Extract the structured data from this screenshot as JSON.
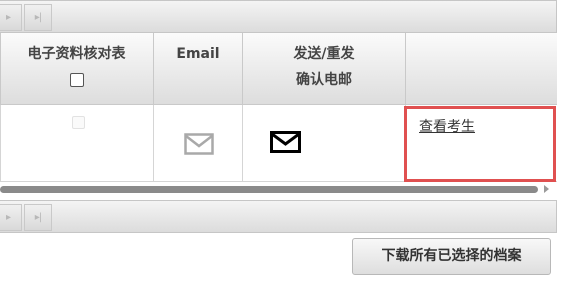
{
  "pager": {
    "next_icon": "next-page-icon",
    "last_icon": "last-page-icon",
    "next_glyph": "▸",
    "last_glyph": "▸|"
  },
  "table": {
    "columns": [
      {
        "label": "电子资料核对表",
        "has_checkbox": true
      },
      {
        "label": "Email"
      },
      {
        "label_line1": "发送/重发",
        "label_line2": "确认电邮"
      },
      {
        "label": ""
      }
    ],
    "rows": [
      {
        "checkbox": false,
        "email_icon": "email-icon",
        "send_icon": "send-email-icon",
        "action_link": "查看考生"
      }
    ]
  },
  "colors": {
    "highlight_border": "#e05050",
    "header_bg": "#e8e8e8"
  },
  "footer": {
    "download_label": "下载所有已选择的档案"
  }
}
